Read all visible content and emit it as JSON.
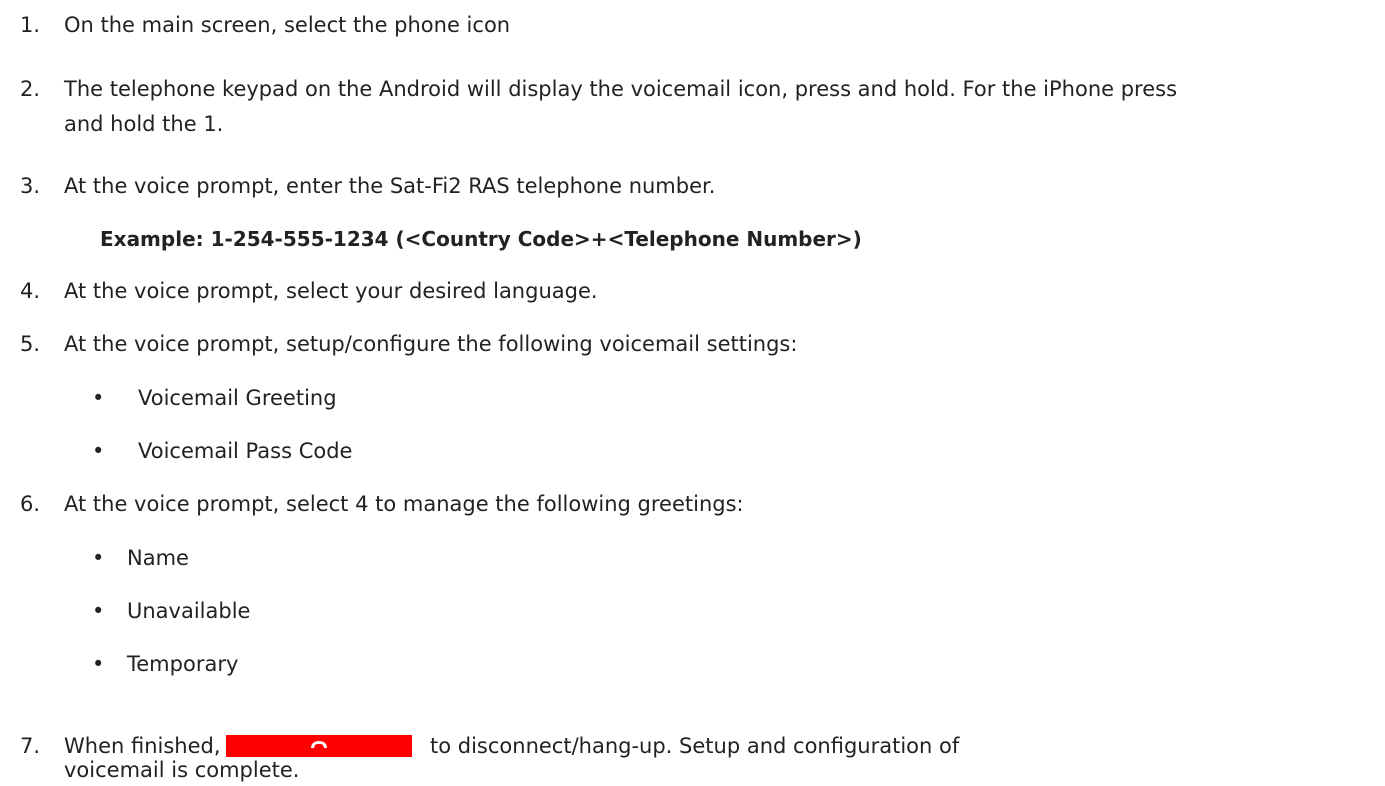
{
  "steps": [
    {
      "num": "1.",
      "text": "On the main screen, select the phone icon"
    },
    {
      "num": "2.",
      "text": "The telephone keypad on the Android will display the voicemail icon, press and hold. For the iPhone press",
      "text_cont": "and hold the 1."
    },
    {
      "num": "3.",
      "text": "At the voice prompt, enter the Sat-Fi2 RAS telephone number."
    },
    {
      "num": "4.",
      "text": "At the voice prompt, select your desired language."
    },
    {
      "num": "5.",
      "text": "At the voice prompt, setup/configure the following voicemail settings:"
    },
    {
      "num": "6.",
      "text": "At the voice prompt, select 4 to manage the following greetings:"
    },
    {
      "num": "7.",
      "text_before": "When finished, select",
      "text_after": "to disconnect/hang-up. Setup and configuration of",
      "text_cont": "voicemail is complete."
    }
  ],
  "example": "Example: 1-254-555-1234 (<Country Code>+<Telephone Number>)",
  "bullet_char": "•",
  "step5_bullets": [
    "Voicemail Greeting",
    "Voicemail Pass Code"
  ],
  "step6_bullets": [
    "Name",
    "Unavailable",
    "Temporary"
  ],
  "hangup_button": {
    "icon": "hang-up-phone-icon",
    "color": "#ff0000"
  }
}
